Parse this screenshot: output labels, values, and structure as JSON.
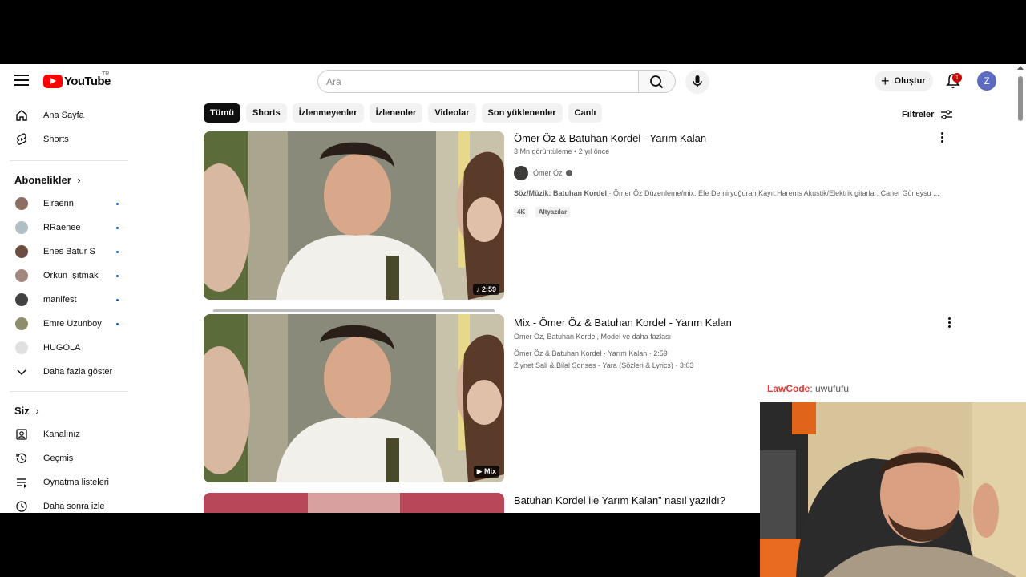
{
  "header": {
    "logo_text": "YouTube",
    "logo_country": "TR",
    "search_placeholder": "Ara",
    "create_label": "Oluştur",
    "notification_count": "1",
    "avatar_letter": "Z"
  },
  "sidebar": {
    "home": "Ana Sayfa",
    "shorts": "Shorts",
    "subscriptions_heading": "Abonelikler",
    "channels": [
      {
        "name": "Elraenn",
        "color": "#8d6e63"
      },
      {
        "name": "RRaenee",
        "color": "#b0bec5"
      },
      {
        "name": "Enes Batur S",
        "color": "#6d4c41"
      },
      {
        "name": "Orkun Işıtmak",
        "color": "#a1887f"
      },
      {
        "name": "manifest",
        "color": "#424242"
      },
      {
        "name": "Emre Uzunboy",
        "color": "#8d8d6d"
      },
      {
        "name": "HUGOLA",
        "color": "#e0e0e0"
      }
    ],
    "show_more": "Daha fazla göster",
    "you_heading": "Siz",
    "you_items": [
      "Kanalınız",
      "Geçmiş",
      "Oynatma listeleri",
      "Daha sonra izle"
    ]
  },
  "chips": [
    "Tümü",
    "Shorts",
    "İzlenmeyenler",
    "İzlenenler",
    "Videolar",
    "Son yüklenenler",
    "Canlı"
  ],
  "filters_label": "Filtreler",
  "results": [
    {
      "title": "Ömer Öz & Batuhan Kordel - Yarım Kalan",
      "meta": "3 Mn görüntüleme • 2 yıl önce",
      "channel": "Ömer Öz",
      "desc_bold": "Söz/Müzik: Batuhan Kordel",
      "desc_rest": " · Ömer Öz Düzenleme/mix: Efe Demiryoğuran Kayıt:Harems Akustik/Elektrik gitarlar: Caner Güneysu ...",
      "tags": [
        "4K",
        "Altyazılar"
      ],
      "badge": "♪ 2:59"
    },
    {
      "title": "Mix - Ömer Öz & Batuhan Kordel - Yarım Kalan",
      "meta": "Ömer Öz, Batuhan Kordel, Model ve daha fazlası",
      "line1": "Ömer Öz & Batuhan Kordel · Yarım Kalan · 2:59",
      "line2": "Ziynet Sali & Bilal Sonses - Yara (Sözleri & Lyrics) · 3:03",
      "badge": "▶ Mix"
    },
    {
      "title": "Batuhan Kordel ile Yarım Kalan” nasıl yazıldı?"
    }
  ],
  "overlay": {
    "name": "LawCode",
    "message": ": uwufufu"
  }
}
